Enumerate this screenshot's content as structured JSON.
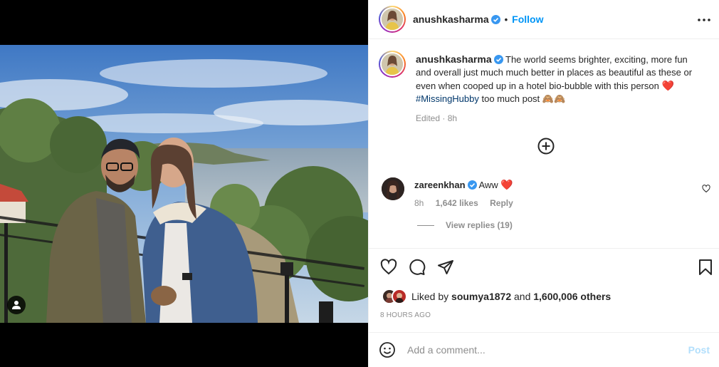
{
  "post": {
    "author": "anushkasharma",
    "follow_label": "Follow",
    "header_separator": "•",
    "caption": {
      "author": "anushkasharma",
      "text": "The world seems brighter, exciting, more fun and overall just much much better in places as beautiful as these or even when cooped up in a hotel bio-bubble with this person",
      "emoji": "❤️",
      "hashtag": "#MissingHubby",
      "suffix": "too much post 🙈🙈",
      "edited": "Edited · 8h"
    }
  },
  "comments": [
    {
      "author": "zareenkhan",
      "text": "Aww",
      "emoji": "❤️",
      "time": "8h",
      "likes": "1,642 likes",
      "reply_label": "Reply",
      "view_replies": "View replies (19)"
    }
  ],
  "engagement": {
    "liked_by_prefix": "Liked by",
    "liked_by_user": "soumya1872",
    "and_word": "and",
    "others": "1,600,006 others",
    "timestamp": "8 HOURS AGO"
  },
  "add_comment": {
    "placeholder": "Add a comment...",
    "post_label": "Post"
  },
  "colors": {
    "accent": "#0095f6",
    "verified": "#3897f0",
    "heart": "#ed4956",
    "hashtag": "#00376b",
    "muted": "#8e8e8e",
    "post_disabled": "#b2dffc"
  },
  "icons": {
    "more": "more-options-icon",
    "new_comment": "plus-circle-icon",
    "like": "heart-outline-icon",
    "comment": "comment-bubble-icon",
    "share": "paper-plane-icon",
    "save": "bookmark-icon",
    "emoji": "smiley-icon",
    "tag": "user-tag-icon"
  }
}
